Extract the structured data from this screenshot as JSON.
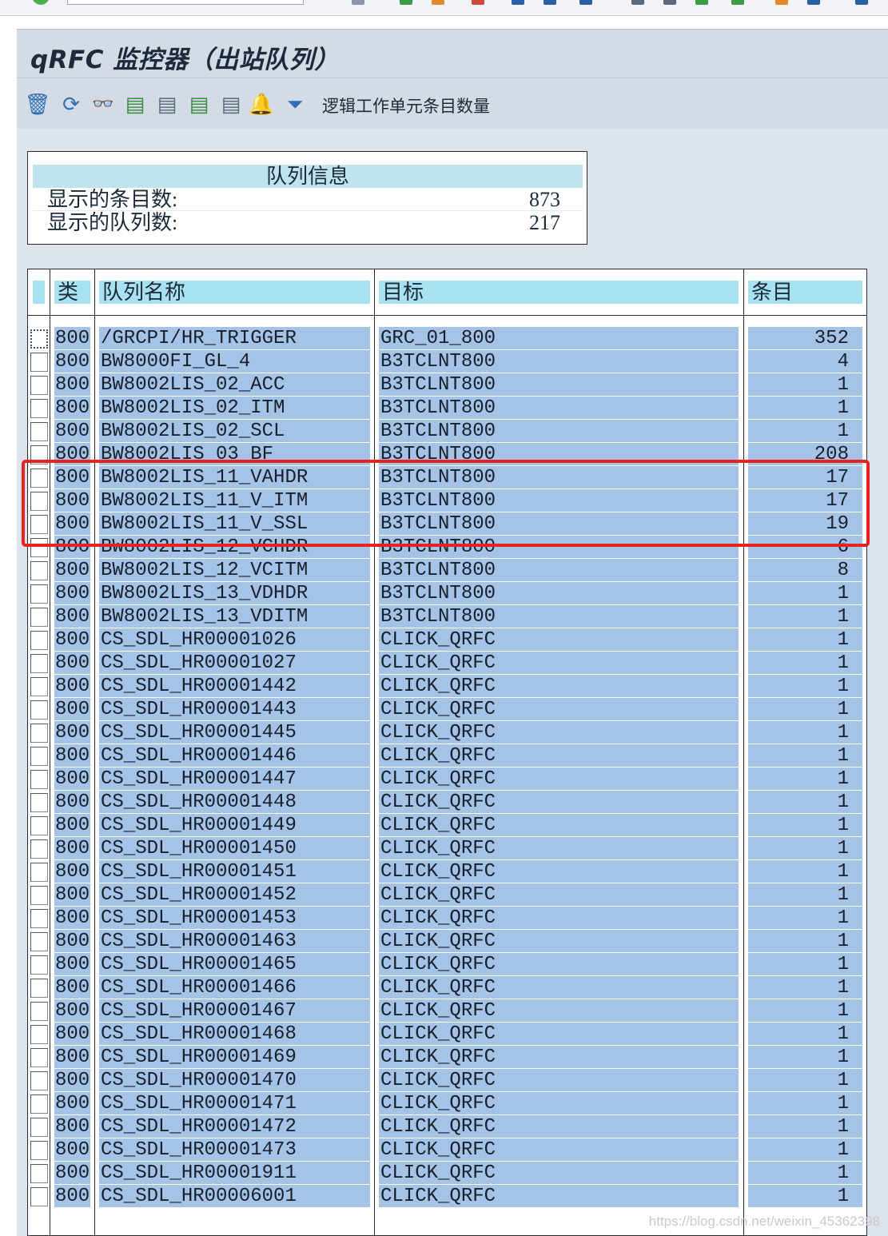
{
  "window": {
    "title": "qRFC 监控器（出站队列）"
  },
  "toolbar": {
    "icons": [
      "delete-icon",
      "refresh-icon",
      "display-icon",
      "layout-icon",
      "export-icon",
      "print-icon",
      "details-icon",
      "alert-icon",
      "filter-icon"
    ],
    "text_button": "逻辑工作单元条目数量"
  },
  "queue_info": {
    "title": "队列信息",
    "entries_label": "显示的条目数:",
    "entries_value": "873",
    "queues_label": "显示的队列数:",
    "queues_value": "217"
  },
  "table": {
    "columns": [
      "类",
      "队列名称",
      "目标",
      "条目"
    ],
    "rows": [
      {
        "cls": "800",
        "name": "/GRCPI/HR_TRIGGER",
        "dest": "GRC_01_800",
        "count": "352"
      },
      {
        "cls": "800",
        "name": "BW8000FI_GL_4",
        "dest": "B3TCLNT800",
        "count": "4"
      },
      {
        "cls": "800",
        "name": "BW8002LIS_02_ACC",
        "dest": "B3TCLNT800",
        "count": "1"
      },
      {
        "cls": "800",
        "name": "BW8002LIS_02_ITM",
        "dest": "B3TCLNT800",
        "count": "1"
      },
      {
        "cls": "800",
        "name": "BW8002LIS_02_SCL",
        "dest": "B3TCLNT800",
        "count": "1"
      },
      {
        "cls": "800",
        "name": "BW8002LIS_03_BF",
        "dest": "B3TCLNT800",
        "count": "208"
      },
      {
        "cls": "800",
        "name": "BW8002LIS_11_VAHDR",
        "dest": "B3TCLNT800",
        "count": "17"
      },
      {
        "cls": "800",
        "name": "BW8002LIS_11_V_ITM",
        "dest": "B3TCLNT800",
        "count": "17"
      },
      {
        "cls": "800",
        "name": "BW8002LIS_11_V_SSL",
        "dest": "B3TCLNT800",
        "count": "19"
      },
      {
        "cls": "800",
        "name": "BW8002LIS_12_VCHDR",
        "dest": "B3TCLNT800",
        "count": "6"
      },
      {
        "cls": "800",
        "name": "BW8002LIS_12_VCITM",
        "dest": "B3TCLNT800",
        "count": "8"
      },
      {
        "cls": "800",
        "name": "BW8002LIS_13_VDHDR",
        "dest": "B3TCLNT800",
        "count": "1"
      },
      {
        "cls": "800",
        "name": "BW8002LIS_13_VDITM",
        "dest": "B3TCLNT800",
        "count": "1"
      },
      {
        "cls": "800",
        "name": "CS_SDL_HR00001026",
        "dest": "CLICK_QRFC",
        "count": "1"
      },
      {
        "cls": "800",
        "name": "CS_SDL_HR00001027",
        "dest": "CLICK_QRFC",
        "count": "1"
      },
      {
        "cls": "800",
        "name": "CS_SDL_HR00001442",
        "dest": "CLICK_QRFC",
        "count": "1"
      },
      {
        "cls": "800",
        "name": "CS_SDL_HR00001443",
        "dest": "CLICK_QRFC",
        "count": "1"
      },
      {
        "cls": "800",
        "name": "CS_SDL_HR00001445",
        "dest": "CLICK_QRFC",
        "count": "1"
      },
      {
        "cls": "800",
        "name": "CS_SDL_HR00001446",
        "dest": "CLICK_QRFC",
        "count": "1"
      },
      {
        "cls": "800",
        "name": "CS_SDL_HR00001447",
        "dest": "CLICK_QRFC",
        "count": "1"
      },
      {
        "cls": "800",
        "name": "CS_SDL_HR00001448",
        "dest": "CLICK_QRFC",
        "count": "1"
      },
      {
        "cls": "800",
        "name": "CS_SDL_HR00001449",
        "dest": "CLICK_QRFC",
        "count": "1"
      },
      {
        "cls": "800",
        "name": "CS_SDL_HR00001450",
        "dest": "CLICK_QRFC",
        "count": "1"
      },
      {
        "cls": "800",
        "name": "CS_SDL_HR00001451",
        "dest": "CLICK_QRFC",
        "count": "1"
      },
      {
        "cls": "800",
        "name": "CS_SDL_HR00001452",
        "dest": "CLICK_QRFC",
        "count": "1"
      },
      {
        "cls": "800",
        "name": "CS_SDL_HR00001453",
        "dest": "CLICK_QRFC",
        "count": "1"
      },
      {
        "cls": "800",
        "name": "CS_SDL_HR00001463",
        "dest": "CLICK_QRFC",
        "count": "1"
      },
      {
        "cls": "800",
        "name": "CS_SDL_HR00001465",
        "dest": "CLICK_QRFC",
        "count": "1"
      },
      {
        "cls": "800",
        "name": "CS_SDL_HR00001466",
        "dest": "CLICK_QRFC",
        "count": "1"
      },
      {
        "cls": "800",
        "name": "CS_SDL_HR00001467",
        "dest": "CLICK_QRFC",
        "count": "1"
      },
      {
        "cls": "800",
        "name": "CS_SDL_HR00001468",
        "dest": "CLICK_QRFC",
        "count": "1"
      },
      {
        "cls": "800",
        "name": "CS_SDL_HR00001469",
        "dest": "CLICK_QRFC",
        "count": "1"
      },
      {
        "cls": "800",
        "name": "CS_SDL_HR00001470",
        "dest": "CLICK_QRFC",
        "count": "1"
      },
      {
        "cls": "800",
        "name": "CS_SDL_HR00001471",
        "dest": "CLICK_QRFC",
        "count": "1"
      },
      {
        "cls": "800",
        "name": "CS_SDL_HR00001472",
        "dest": "CLICK_QRFC",
        "count": "1"
      },
      {
        "cls": "800",
        "name": "CS_SDL_HR00001473",
        "dest": "CLICK_QRFC",
        "count": "1"
      },
      {
        "cls": "800",
        "name": "CS_SDL_HR00001911",
        "dest": "CLICK_QRFC",
        "count": "1"
      },
      {
        "cls": "800",
        "name": "CS_SDL_HR00006001",
        "dest": "CLICK_QRFC",
        "count": "1"
      }
    ]
  },
  "watermark": "https://blog.csdn.net/weixin_45362398",
  "colors": {
    "row_background": "#a4c3e6",
    "header_background": "#a8e2f0",
    "highlight_border": "#e8221e",
    "screen_background": "#dde4ec"
  }
}
